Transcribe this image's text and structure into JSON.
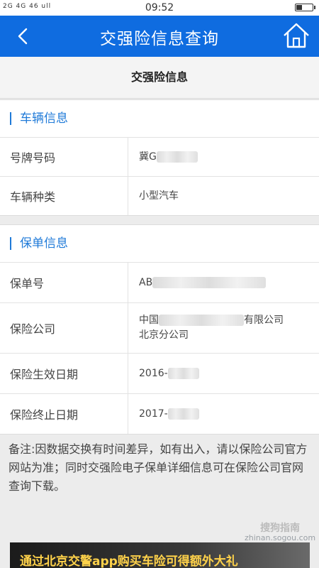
{
  "status": {
    "left": "2G 4G 46 ull",
    "time": "09:52"
  },
  "nav": {
    "title": "交强险信息查询"
  },
  "header": {
    "title": "交强险信息"
  },
  "vehicle": {
    "title": "车辆信息",
    "plate_label": "号牌号码",
    "plate_value": "冀G",
    "type_label": "车辆种类",
    "type_value": "小型汽车"
  },
  "policy": {
    "title": "保单信息",
    "number_label": "保单号",
    "number_value": "AB",
    "company_label": "保险公司",
    "company_line1_a": "中国",
    "company_line1_b": "有限公司",
    "company_line2": "北京分公司",
    "start_label": "保险生效日期",
    "start_value": "2016-",
    "end_label": "保险终止日期",
    "end_value": "2017-"
  },
  "note": {
    "text": "备注:因数据交换有时间差异，如有出入，请以保险公司官方网站为准；同时交强险电子保单详细信息可在保险公司官网查询下载。"
  },
  "banner": {
    "text": "通过北京交警app购买车险可得额外大礼"
  },
  "watermark": {
    "line1": "搜狗指南",
    "line2": "zhinan.sogou.com"
  },
  "icons": {
    "back": "chevron-left-icon",
    "home": "home-icon"
  },
  "colors": {
    "navbar": "#0f6ce0",
    "accent": "#1f7ad8"
  }
}
